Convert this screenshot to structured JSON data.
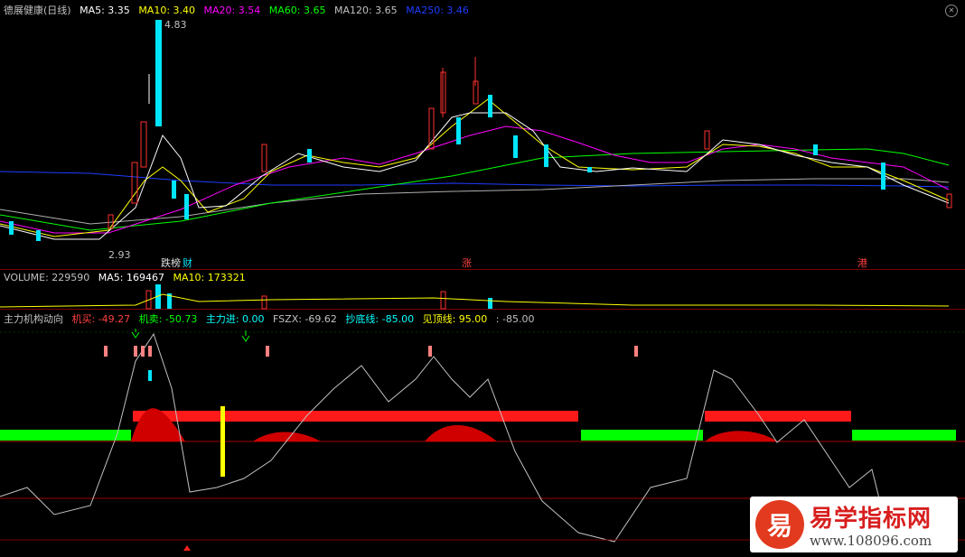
{
  "main": {
    "title": "德展健康(日线)",
    "ma": [
      {
        "label": "MA5: 3.35",
        "color": "#ffffff"
      },
      {
        "label": "MA10: 3.40",
        "color": "#ffff00"
      },
      {
        "label": "MA20: 3.54",
        "color": "#ff00ff"
      },
      {
        "label": "MA60: 3.65",
        "color": "#00ff00"
      },
      {
        "label": "MA120: 3.65",
        "color": "#c0c0c0"
      },
      {
        "label": "MA250: 3.46",
        "color": "#1e3cff"
      }
    ],
    "high_label": "4.83",
    "low_label": "2.93",
    "tags": [
      "跌榜",
      "财",
      "涨",
      "港"
    ]
  },
  "volume": {
    "title": "VOLUME: 229590",
    "ma5": "MA5: 169467",
    "ma10": "MA10: 173321"
  },
  "indicator": {
    "title": "主力机构动向",
    "items": [
      {
        "label": "机买: -49.27",
        "color": "#ff4040"
      },
      {
        "label": "机卖: -50.73",
        "color": "#00ff00"
      },
      {
        "label": "主力进: 0.00",
        "color": "#00ffff"
      },
      {
        "label": "FSZX: -69.62",
        "color": "#c0c0c0"
      },
      {
        "label": "抄底线: -85.00",
        "color": "#00ffff"
      },
      {
        "label": "见顶线: 95.00",
        "color": "#ffff00"
      },
      {
        "label": ": -85.00",
        "color": "#c0c0c0"
      }
    ]
  },
  "logo": {
    "badge": "易",
    "name": "易学指标网",
    "url": "www.108096.com"
  },
  "colors": {
    "up": "#ff3030",
    "down": "#00e5ff",
    "bg": "#000000"
  }
}
